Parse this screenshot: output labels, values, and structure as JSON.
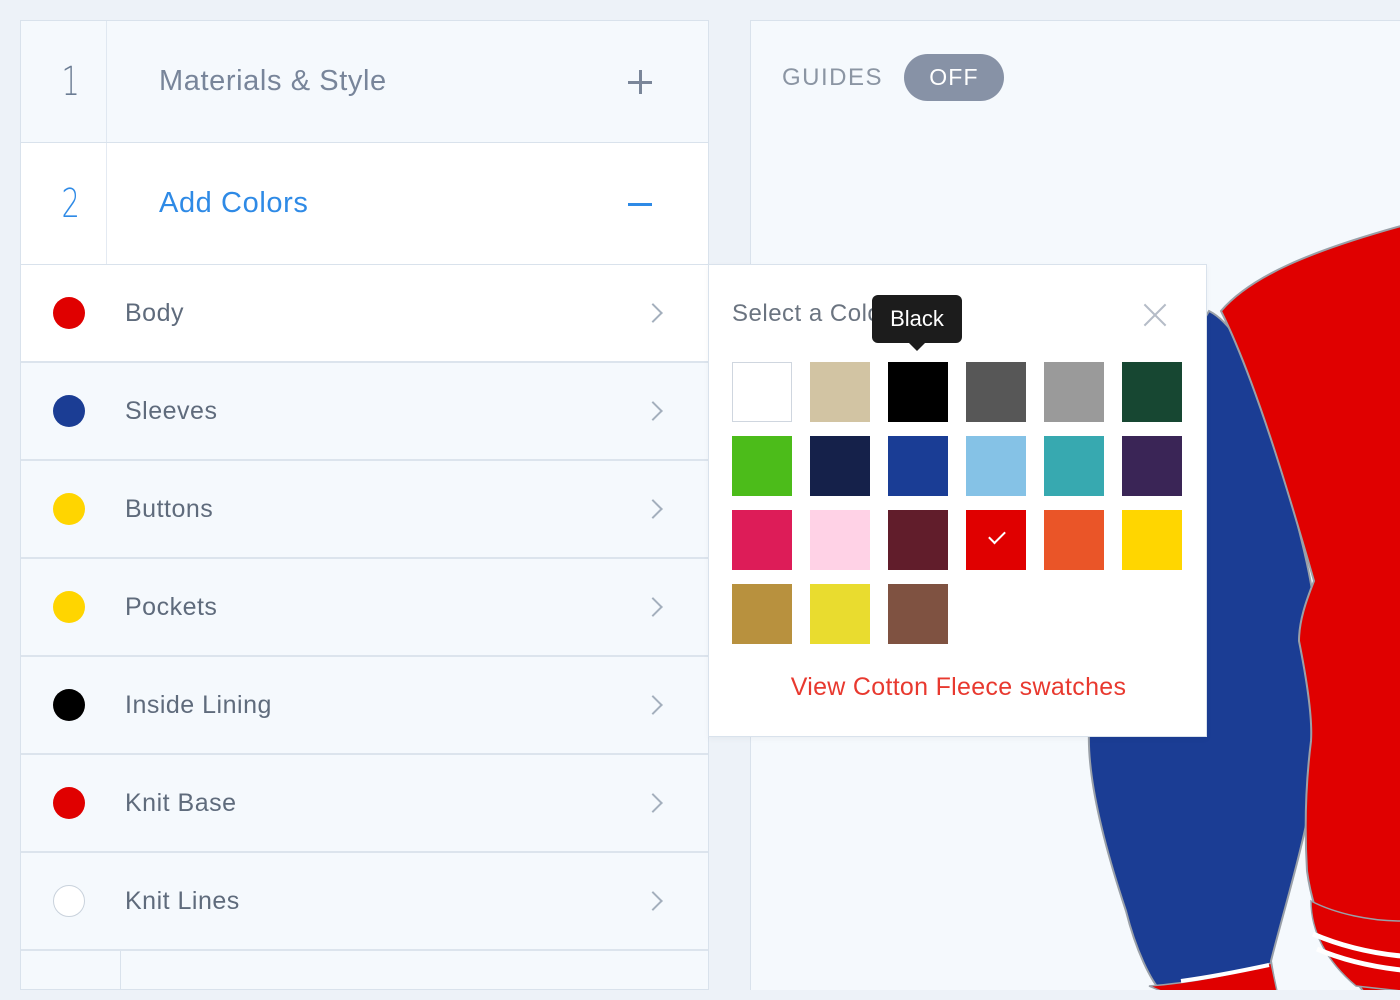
{
  "steps": [
    {
      "number": "1",
      "title": "Materials & Style",
      "toggle": "plus",
      "expanded": false
    },
    {
      "number": "2",
      "title": "Add Colors",
      "toggle": "minus",
      "expanded": true
    }
  ],
  "parts": [
    {
      "label": "Body",
      "color": "#e00000",
      "active": true
    },
    {
      "label": "Sleeves",
      "color": "#1b3d94",
      "active": false
    },
    {
      "label": "Buttons",
      "color": "#ffd500",
      "active": false
    },
    {
      "label": "Pockets",
      "color": "#ffd500",
      "active": false
    },
    {
      "label": "Inside Lining",
      "color": "#000000",
      "active": false
    },
    {
      "label": "Knit Base",
      "color": "#e00000",
      "active": false
    },
    {
      "label": "Knit Lines",
      "color": "#ffffff",
      "active": false
    }
  ],
  "guides": {
    "label": "GUIDES",
    "state": "OFF"
  },
  "color_picker": {
    "title": "Select a Color",
    "tooltip": "Black",
    "link": "View Cotton Fleece swatches",
    "selected_color": "#e00000",
    "swatches": [
      "#ffffff",
      "#d2c4a3",
      "#000000",
      "#575757",
      "#9a9a9a",
      "#174732",
      "#4cbc1a",
      "#15214a",
      "#1a3d95",
      "#85c2e6",
      "#37a9b0",
      "#3a2556",
      "#dd1c58",
      "#ffd2e6",
      "#611d2b",
      "#e00000",
      "#ea5528",
      "#ffd600",
      "#b8913e",
      "#e9dc2f",
      "#7f5241"
    ]
  },
  "jacket": {
    "body_color": "#e00000",
    "sleeve_color": "#1b3d94",
    "knit_line_color": "#ffffff"
  }
}
